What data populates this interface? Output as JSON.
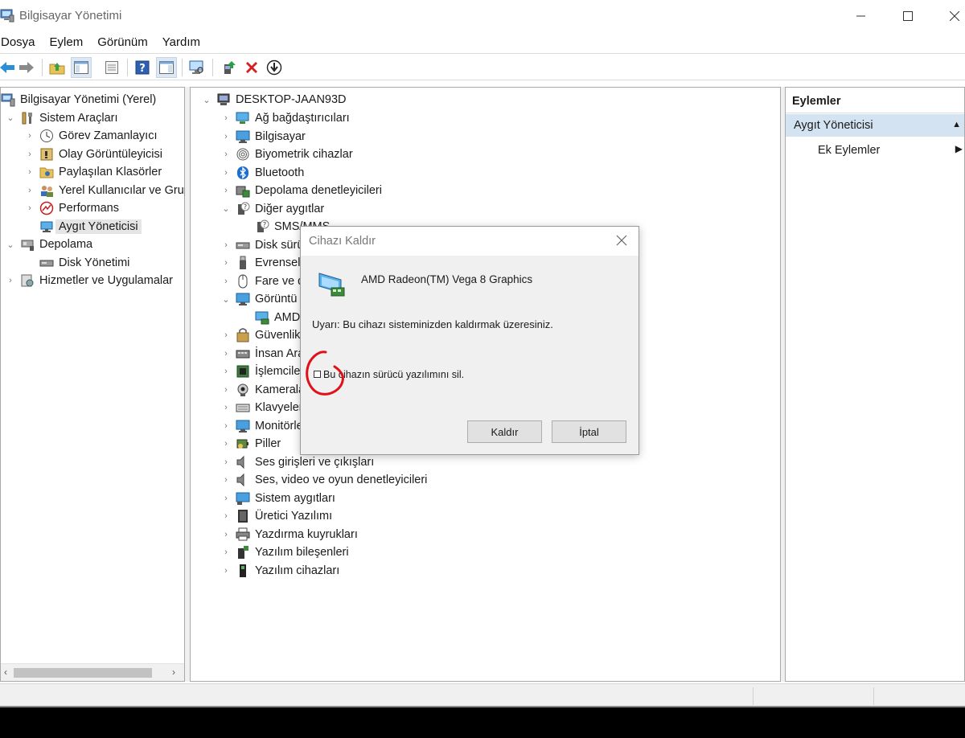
{
  "window": {
    "title": "Bilgisayar Yönetimi"
  },
  "menu": [
    "Dosya",
    "Eylem",
    "Görünüm",
    "Yardım"
  ],
  "left_tree": [
    {
      "label": "Bilgisayar Yönetimi (Yerel)",
      "icon": "computer-management-icon",
      "chev": ""
    },
    {
      "label": "Sistem Araçları",
      "icon": "tools-icon",
      "chev": "⌄"
    },
    {
      "label": "Görev Zamanlayıcı",
      "icon": "clock-icon",
      "chev": "›"
    },
    {
      "label": "Olay Görüntüleyicisi",
      "icon": "event-viewer-icon",
      "chev": "›"
    },
    {
      "label": "Paylaşılan Klasörler",
      "icon": "shared-folder-icon",
      "chev": "›"
    },
    {
      "label": "Yerel Kullanıcılar ve Grup",
      "icon": "users-icon",
      "chev": "›"
    },
    {
      "label": "Performans",
      "icon": "performance-icon",
      "chev": "›"
    },
    {
      "label": "Aygıt Yöneticisi",
      "icon": "device-manager-icon",
      "chev": ""
    },
    {
      "label": "Depolama",
      "icon": "storage-icon",
      "chev": "⌄"
    },
    {
      "label": "Disk Yönetimi",
      "icon": "disk-icon",
      "chev": ""
    },
    {
      "label": "Hizmetler ve Uygulamalar",
      "icon": "services-icon",
      "chev": "›"
    }
  ],
  "device_tree": {
    "root": "DESKTOP-JAAN93D",
    "items": [
      {
        "label": "Ağ bağdaştırıcıları",
        "chev": "›"
      },
      {
        "label": "Bilgisayar",
        "chev": "›"
      },
      {
        "label": "Biyometrik cihazlar",
        "chev": "›"
      },
      {
        "label": "Bluetooth",
        "chev": "›"
      },
      {
        "label": "Depolama denetleyicileri",
        "chev": "›"
      },
      {
        "label": "Diğer aygıtlar",
        "chev": "⌄"
      },
      {
        "label": "SMS/MMS",
        "chev": ""
      },
      {
        "label": "Disk sürü",
        "chev": "›"
      },
      {
        "label": "Evrensel S",
        "chev": "›"
      },
      {
        "label": "Fare ve d",
        "chev": "›"
      },
      {
        "label": "Görüntü",
        "chev": "⌄"
      },
      {
        "label": "AMD",
        "chev": ""
      },
      {
        "label": "Güvenlik",
        "chev": "›"
      },
      {
        "label": "İnsan Ara",
        "chev": "›"
      },
      {
        "label": "İşlemciler",
        "chev": "›"
      },
      {
        "label": "Kameralar",
        "chev": "›"
      },
      {
        "label": "Klavyeler",
        "chev": "›"
      },
      {
        "label": "Monitörle",
        "chev": "›"
      },
      {
        "label": "Piller",
        "chev": "›"
      },
      {
        "label": "Ses girişleri ve çıkışları",
        "chev": "›"
      },
      {
        "label": "Ses, video ve oyun denetleyicileri",
        "chev": "›"
      },
      {
        "label": "Sistem aygıtları",
        "chev": "›"
      },
      {
        "label": "Üretici Yazılımı",
        "chev": "›"
      },
      {
        "label": "Yazdırma kuyrukları",
        "chev": "›"
      },
      {
        "label": "Yazılım bileşenleri",
        "chev": "›"
      },
      {
        "label": "Yazılım cihazları",
        "chev": "›"
      }
    ]
  },
  "actions": {
    "title": "Eylemler",
    "section": "Aygıt Yöneticisi",
    "item": "Ek Eylemler"
  },
  "dialog": {
    "title": "Cihazı Kaldır",
    "device_name": "AMD Radeon(TM) Vega 8 Graphics",
    "warning": "Uyarı: Bu cihazı sisteminizden kaldırmak üzeresiniz.",
    "checkbox_label": "Bu cihazın sürücü yazılımını sil.",
    "checkbox_checked": false,
    "ok_label": "Kaldır",
    "cancel_label": "İptal"
  },
  "colors": {
    "selection": "#e5e5e5",
    "actions_header": "#d4e3f2",
    "annotation_red": "#e0101a"
  }
}
